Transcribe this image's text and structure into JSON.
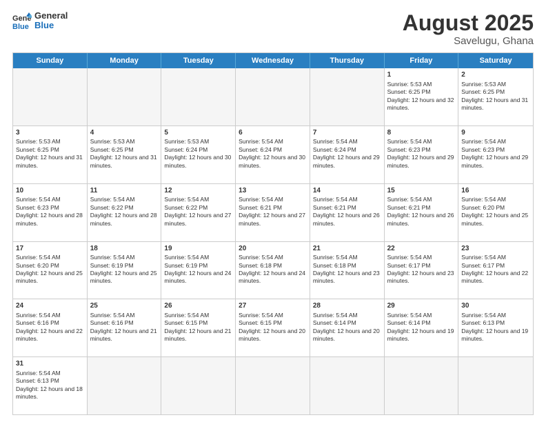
{
  "logo": {
    "text_general": "General",
    "text_blue": "Blue"
  },
  "title": "August 2025",
  "subtitle": "Savelugu, Ghana",
  "days": [
    "Sunday",
    "Monday",
    "Tuesday",
    "Wednesday",
    "Thursday",
    "Friday",
    "Saturday"
  ],
  "rows": [
    [
      {
        "day": "",
        "empty": true
      },
      {
        "day": "",
        "empty": true
      },
      {
        "day": "",
        "empty": true
      },
      {
        "day": "",
        "empty": true
      },
      {
        "day": "",
        "empty": true
      },
      {
        "day": "1",
        "sunrise": "5:53 AM",
        "sunset": "6:25 PM",
        "daylight": "12 hours and 32 minutes."
      },
      {
        "day": "2",
        "sunrise": "5:53 AM",
        "sunset": "6:25 PM",
        "daylight": "12 hours and 31 minutes."
      }
    ],
    [
      {
        "day": "3",
        "sunrise": "5:53 AM",
        "sunset": "6:25 PM",
        "daylight": "12 hours and 31 minutes."
      },
      {
        "day": "4",
        "sunrise": "5:53 AM",
        "sunset": "6:25 PM",
        "daylight": "12 hours and 31 minutes."
      },
      {
        "day": "5",
        "sunrise": "5:53 AM",
        "sunset": "6:24 PM",
        "daylight": "12 hours and 30 minutes."
      },
      {
        "day": "6",
        "sunrise": "5:54 AM",
        "sunset": "6:24 PM",
        "daylight": "12 hours and 30 minutes."
      },
      {
        "day": "7",
        "sunrise": "5:54 AM",
        "sunset": "6:24 PM",
        "daylight": "12 hours and 29 minutes."
      },
      {
        "day": "8",
        "sunrise": "5:54 AM",
        "sunset": "6:23 PM",
        "daylight": "12 hours and 29 minutes."
      },
      {
        "day": "9",
        "sunrise": "5:54 AM",
        "sunset": "6:23 PM",
        "daylight": "12 hours and 29 minutes."
      }
    ],
    [
      {
        "day": "10",
        "sunrise": "5:54 AM",
        "sunset": "6:23 PM",
        "daylight": "12 hours and 28 minutes."
      },
      {
        "day": "11",
        "sunrise": "5:54 AM",
        "sunset": "6:22 PM",
        "daylight": "12 hours and 28 minutes."
      },
      {
        "day": "12",
        "sunrise": "5:54 AM",
        "sunset": "6:22 PM",
        "daylight": "12 hours and 27 minutes."
      },
      {
        "day": "13",
        "sunrise": "5:54 AM",
        "sunset": "6:21 PM",
        "daylight": "12 hours and 27 minutes."
      },
      {
        "day": "14",
        "sunrise": "5:54 AM",
        "sunset": "6:21 PM",
        "daylight": "12 hours and 26 minutes."
      },
      {
        "day": "15",
        "sunrise": "5:54 AM",
        "sunset": "6:21 PM",
        "daylight": "12 hours and 26 minutes."
      },
      {
        "day": "16",
        "sunrise": "5:54 AM",
        "sunset": "6:20 PM",
        "daylight": "12 hours and 25 minutes."
      }
    ],
    [
      {
        "day": "17",
        "sunrise": "5:54 AM",
        "sunset": "6:20 PM",
        "daylight": "12 hours and 25 minutes."
      },
      {
        "day": "18",
        "sunrise": "5:54 AM",
        "sunset": "6:19 PM",
        "daylight": "12 hours and 25 minutes."
      },
      {
        "day": "19",
        "sunrise": "5:54 AM",
        "sunset": "6:19 PM",
        "daylight": "12 hours and 24 minutes."
      },
      {
        "day": "20",
        "sunrise": "5:54 AM",
        "sunset": "6:18 PM",
        "daylight": "12 hours and 24 minutes."
      },
      {
        "day": "21",
        "sunrise": "5:54 AM",
        "sunset": "6:18 PM",
        "daylight": "12 hours and 23 minutes."
      },
      {
        "day": "22",
        "sunrise": "5:54 AM",
        "sunset": "6:17 PM",
        "daylight": "12 hours and 23 minutes."
      },
      {
        "day": "23",
        "sunrise": "5:54 AM",
        "sunset": "6:17 PM",
        "daylight": "12 hours and 22 minutes."
      }
    ],
    [
      {
        "day": "24",
        "sunrise": "5:54 AM",
        "sunset": "6:16 PM",
        "daylight": "12 hours and 22 minutes."
      },
      {
        "day": "25",
        "sunrise": "5:54 AM",
        "sunset": "6:16 PM",
        "daylight": "12 hours and 21 minutes."
      },
      {
        "day": "26",
        "sunrise": "5:54 AM",
        "sunset": "6:15 PM",
        "daylight": "12 hours and 21 minutes."
      },
      {
        "day": "27",
        "sunrise": "5:54 AM",
        "sunset": "6:15 PM",
        "daylight": "12 hours and 20 minutes."
      },
      {
        "day": "28",
        "sunrise": "5:54 AM",
        "sunset": "6:14 PM",
        "daylight": "12 hours and 20 minutes."
      },
      {
        "day": "29",
        "sunrise": "5:54 AM",
        "sunset": "6:14 PM",
        "daylight": "12 hours and 19 minutes."
      },
      {
        "day": "30",
        "sunrise": "5:54 AM",
        "sunset": "6:13 PM",
        "daylight": "12 hours and 19 minutes."
      }
    ],
    [
      {
        "day": "31",
        "sunrise": "5:54 AM",
        "sunset": "6:13 PM",
        "daylight": "12 hours and 18 minutes."
      },
      {
        "day": "",
        "empty": true
      },
      {
        "day": "",
        "empty": true
      },
      {
        "day": "",
        "empty": true
      },
      {
        "day": "",
        "empty": true
      },
      {
        "day": "",
        "empty": true
      },
      {
        "day": "",
        "empty": true
      }
    ]
  ]
}
